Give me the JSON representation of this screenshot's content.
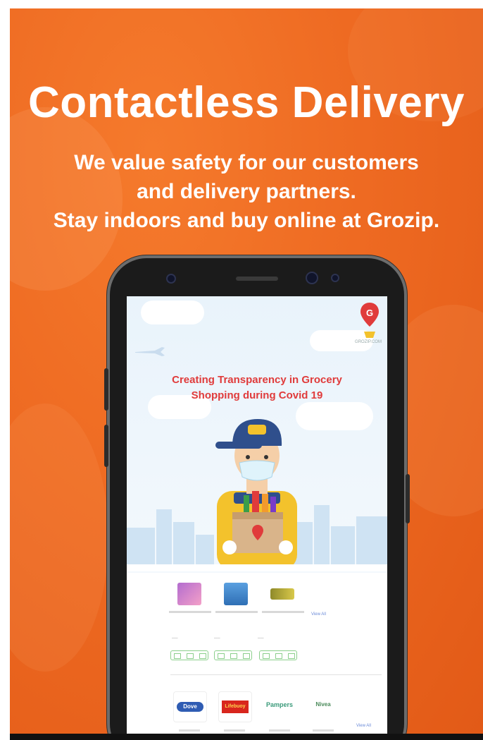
{
  "poster": {
    "headline": "Contactless Delivery",
    "sub_lines": [
      "We value safety for our customers",
      "and delivery partners.",
      "Stay indoors and buy online at Grozip."
    ]
  },
  "app_screen": {
    "promo_title_line1": "Creating Transparency in Grocery",
    "promo_title_line2": "Shopping during Covid 19",
    "logo_letter": "G",
    "logo_text": "GROZIP.COM",
    "view_all_label": "View All",
    "brand_labels": [
      "Dove",
      "Lifebuoy",
      "Pampers",
      "Nivea"
    ]
  },
  "colors": {
    "poster_orange": "#ee6a22",
    "accent_red": "#e03b3b",
    "courier_yellow": "#f3c22c",
    "courier_blue": "#2f4f8c"
  }
}
